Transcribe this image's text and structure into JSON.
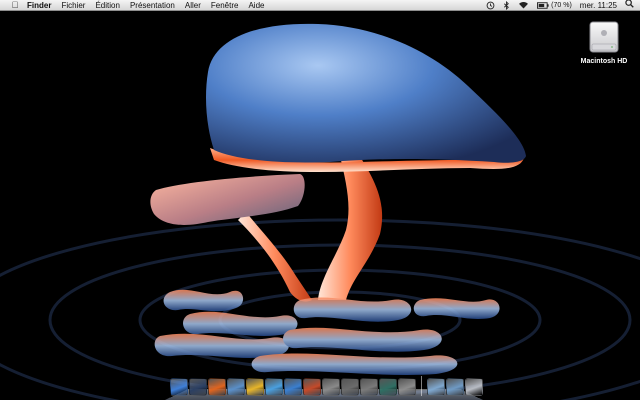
{
  "menubar": {
    "app_name": "Finder",
    "menus": [
      "Fichier",
      "Édition",
      "Présentation",
      "Aller",
      "Fenêtre",
      "Aide"
    ],
    "battery_text": "(70 %)",
    "clock": "mer. 11:25"
  },
  "desktop": {
    "drive_label": "Macintosh HD"
  },
  "dock": {
    "items": [
      {
        "icon": "finder-icon",
        "color": "#3f7fd8"
      },
      {
        "icon": "dashboard-icon",
        "color": "#2b3f62"
      },
      {
        "icon": "firefox-icon",
        "color": "#e0641e"
      },
      {
        "icon": "preview-icon",
        "color": "#5a8fc8"
      },
      {
        "icon": "ichat-icon",
        "color": "#e7b52a"
      },
      {
        "icon": "user-icon",
        "color": "#4aa0e0"
      },
      {
        "icon": "safari-icon",
        "color": "#3a7fd0"
      },
      {
        "icon": "photo-booth-icon",
        "color": "#c44a2a"
      },
      {
        "icon": "preview-image-icon",
        "color": "#8a8a8a"
      },
      {
        "icon": "script-editor-icon",
        "color": "#6b6b6b"
      },
      {
        "icon": "automator-icon",
        "color": "#7a7a7a"
      },
      {
        "icon": "time-machine-icon",
        "color": "#2f6e63"
      },
      {
        "icon": "system-preferences-icon",
        "color": "#8d8d8d"
      },
      {
        "icon": "downloads-folder-icon",
        "color": "#7fa8d0"
      },
      {
        "icon": "documents-folder-icon",
        "color": "#6f9ac4"
      },
      {
        "icon": "trash-icon",
        "color": "#b8bcc4"
      }
    ]
  }
}
